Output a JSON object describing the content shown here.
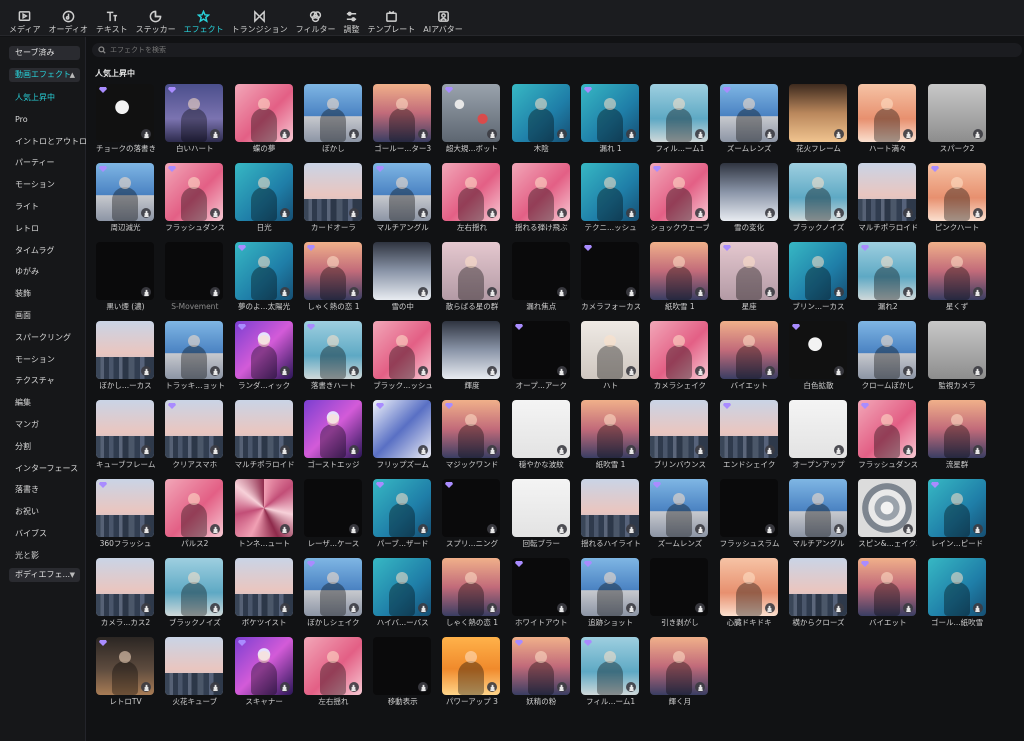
{
  "toolbar": {
    "tools": [
      {
        "label": "メディア",
        "icon": "media-icon"
      },
      {
        "label": "オーディオ",
        "icon": "audio-icon"
      },
      {
        "label": "テキスト",
        "icon": "text-icon"
      },
      {
        "label": "ステッカー",
        "icon": "sticker-icon"
      },
      {
        "label": "エフェクト",
        "icon": "effects-icon",
        "active": true
      },
      {
        "label": "トランジション",
        "icon": "transition-icon"
      },
      {
        "label": "フィルター",
        "icon": "filter-icon"
      },
      {
        "label": "調整",
        "icon": "adjust-icon"
      },
      {
        "label": "テンプレート",
        "icon": "template-icon"
      },
      {
        "label": "AIアバター",
        "icon": "ai-avatar-icon"
      }
    ]
  },
  "sidebar": {
    "saved_label": "セーブ済み",
    "video_effects_label": "動画エフェクト",
    "body_effects_label": "ボディエフェ...",
    "items": [
      "人気上昇中",
      "Pro",
      "イントロとアウトロ",
      "パーティー",
      "モーション",
      "ライト",
      "レトロ",
      "タイムラグ",
      "ゆがみ",
      "装飾",
      "画面",
      "スパークリング",
      "モーション",
      "テクスチャ",
      "編集",
      "マンガ",
      "分割",
      "インターフェース",
      "落書き",
      "お祝い",
      "バイブス",
      "光と影"
    ]
  },
  "search": {
    "placeholder": "エフェクトを検索"
  },
  "section_title": "人気上昇中",
  "colors": {
    "accent": "#28d0d8",
    "background": "#111214",
    "sidebar": "#161719",
    "pill": "#2a2b30"
  },
  "effects": [
    {
      "label": "チョークの落書き",
      "thumb": "dark"
    },
    {
      "label": "白いハート",
      "thumb": "night"
    },
    {
      "label": "蝶の夢",
      "thumb": "pink"
    },
    {
      "label": "ぼかし",
      "thumb": "blue"
    },
    {
      "label": "ゴールー...ター3",
      "thumb": "sunset"
    },
    {
      "label": "超大規...ボット",
      "thumb": "bokeh"
    },
    {
      "label": "木陰",
      "thumb": "teal"
    },
    {
      "label": "漏れ 1",
      "thumb": "teal"
    },
    {
      "label": "フィル...ーム1",
      "thumb": "sky"
    },
    {
      "label": "ズームレンズ",
      "thumb": "blue"
    },
    {
      "label": "花火フレーム",
      "thumb": "warm"
    },
    {
      "label": "ハート満々",
      "thumb": "peach"
    },
    {
      "label": "スパーク2",
      "thumb": "gray"
    },
    {
      "label": "周辺減光",
      "thumb": "blue"
    },
    {
      "label": "フラッシュダンス",
      "thumb": "pink"
    },
    {
      "label": "日光",
      "thumb": "teal"
    },
    {
      "label": "カードオーラ",
      "thumb": "city"
    },
    {
      "label": "マルチアングル",
      "thumb": "blue"
    },
    {
      "label": "左右揺れ",
      "thumb": "pink"
    },
    {
      "label": "揺れる弾け飛ぶ",
      "thumb": "pink"
    },
    {
      "label": "テクニ...ッシュ",
      "thumb": "teal"
    },
    {
      "label": "ショックウェーブ",
      "thumb": "pink"
    },
    {
      "label": "雪の変化",
      "thumb": "snow"
    },
    {
      "label": "ブラックノイズ",
      "thumb": "sky"
    },
    {
      "label": "マルチポラロイド",
      "thumb": "city"
    },
    {
      "label": "ピンクハート",
      "thumb": "peach"
    },
    {
      "label": "黒い煙 (濃)",
      "thumb": "black"
    },
    {
      "label": "S-Movement",
      "thumb": "black",
      "dim": true
    },
    {
      "label": "夢のよ...太陽光",
      "thumb": "teal"
    },
    {
      "label": "しゃく熱の恋 1",
      "thumb": "sunset"
    },
    {
      "label": "雪の中",
      "thumb": "snow"
    },
    {
      "label": "散らばる星の群",
      "thumb": "pinkgray"
    },
    {
      "label": "漏れ焦点",
      "thumb": "black"
    },
    {
      "label": "カメラフォーカス",
      "thumb": "black"
    },
    {
      "label": "紙吹雪 1",
      "thumb": "sunset"
    },
    {
      "label": "星座",
      "thumb": "pinkgray"
    },
    {
      "label": "ブリン...ーカス",
      "thumb": "teal"
    },
    {
      "label": "漏れ2",
      "thumb": "sky"
    },
    {
      "label": "星くず",
      "thumb": "sunset"
    },
    {
      "label": "ぼかし...ーカス",
      "thumb": "city"
    },
    {
      "label": "トラッキ...ョット2",
      "thumb": "blue"
    },
    {
      "label": "ランダ...ィック",
      "thumb": "concert"
    },
    {
      "label": "落書きハート",
      "thumb": "sky"
    },
    {
      "label": "ブラック...ッシュ2",
      "thumb": "pink"
    },
    {
      "label": "輝度",
      "thumb": "snow"
    },
    {
      "label": "オープ...アーク",
      "thumb": "black"
    },
    {
      "label": "ハト",
      "thumb": "light"
    },
    {
      "label": "カメラシェイク",
      "thumb": "pink"
    },
    {
      "label": "バイエット",
      "thumb": "sunset"
    },
    {
      "label": "白色拡散",
      "thumb": "dark"
    },
    {
      "label": "クロームぼかし",
      "thumb": "blue"
    },
    {
      "label": "監視カメラ",
      "thumb": "gray"
    },
    {
      "label": "キューブフレーム",
      "thumb": "city"
    },
    {
      "label": "クリアスマホ",
      "thumb": "city"
    },
    {
      "label": "マルチポラロイド",
      "thumb": "city"
    },
    {
      "label": "ゴーストエッジ",
      "thumb": "concert"
    },
    {
      "label": "フリップズーム",
      "thumb": "bluewhite"
    },
    {
      "label": "マジックワンド",
      "thumb": "sunset"
    },
    {
      "label": "穏やかな波紋",
      "thumb": "white"
    },
    {
      "label": "紙吹雪 1",
      "thumb": "sunset"
    },
    {
      "label": "ブリンバウンス",
      "thumb": "city"
    },
    {
      "label": "エンドシェイク",
      "thumb": "city"
    },
    {
      "label": "オープンアップ",
      "thumb": "white"
    },
    {
      "label": "フラッシュダンス",
      "thumb": "pink"
    },
    {
      "label": "流星群",
      "thumb": "sunset"
    },
    {
      "label": "360フラッシュ",
      "thumb": "city"
    },
    {
      "label": "パルス2",
      "thumb": "pink"
    },
    {
      "label": "トンネ...ュート",
      "thumb": "kaleido"
    },
    {
      "label": "レーザ...ケース",
      "thumb": "black"
    },
    {
      "label": "パーブ...ザード",
      "thumb": "teal"
    },
    {
      "label": "スプリ...ニング",
      "thumb": "black"
    },
    {
      "label": "回転ブラー",
      "thumb": "white"
    },
    {
      "label": "揺れるハイライト",
      "thumb": "city"
    },
    {
      "label": "ズームレンズ",
      "thumb": "blue"
    },
    {
      "label": "フラッシュスラム",
      "thumb": "black"
    },
    {
      "label": "マルチアングル",
      "thumb": "blue"
    },
    {
      "label": "スピン&...ェイク2",
      "thumb": "swirl"
    },
    {
      "label": "レイン...ピード",
      "thumb": "teal"
    },
    {
      "label": "カメラ...カス2",
      "thumb": "city"
    },
    {
      "label": "ブラックノイズ",
      "thumb": "sky"
    },
    {
      "label": "ボケツイスト",
      "thumb": "city"
    },
    {
      "label": "ぼかしシェイク",
      "thumb": "blue"
    },
    {
      "label": "ハイバ...ーバス",
      "thumb": "teal"
    },
    {
      "label": "しゃく熱の恋 1",
      "thumb": "sunset"
    },
    {
      "label": "ホワイトアウト",
      "thumb": "black"
    },
    {
      "label": "追跡ショット",
      "thumb": "blue"
    },
    {
      "label": "引き剥がし",
      "thumb": "black"
    },
    {
      "label": "心臓ドキドキ",
      "thumb": "peach"
    },
    {
      "label": "横からクローズ",
      "thumb": "city"
    },
    {
      "label": "バイエット",
      "thumb": "sunset"
    },
    {
      "label": "ゴール...紙吹雪",
      "thumb": "teal"
    },
    {
      "label": "レトロTV",
      "thumb": "retro"
    },
    {
      "label": "火花キューブ",
      "thumb": "city"
    },
    {
      "label": "スキャナー",
      "thumb": "concert"
    },
    {
      "label": "左右揺れ",
      "thumb": "pink"
    },
    {
      "label": "移動表示",
      "thumb": "black"
    },
    {
      "label": "パワーアップ 3",
      "thumb": "orange"
    },
    {
      "label": "妖精の粉",
      "thumb": "sunset"
    },
    {
      "label": "フィル...ーム1",
      "thumb": "sky"
    },
    {
      "label": "輝く月",
      "thumb": "sunset"
    }
  ]
}
